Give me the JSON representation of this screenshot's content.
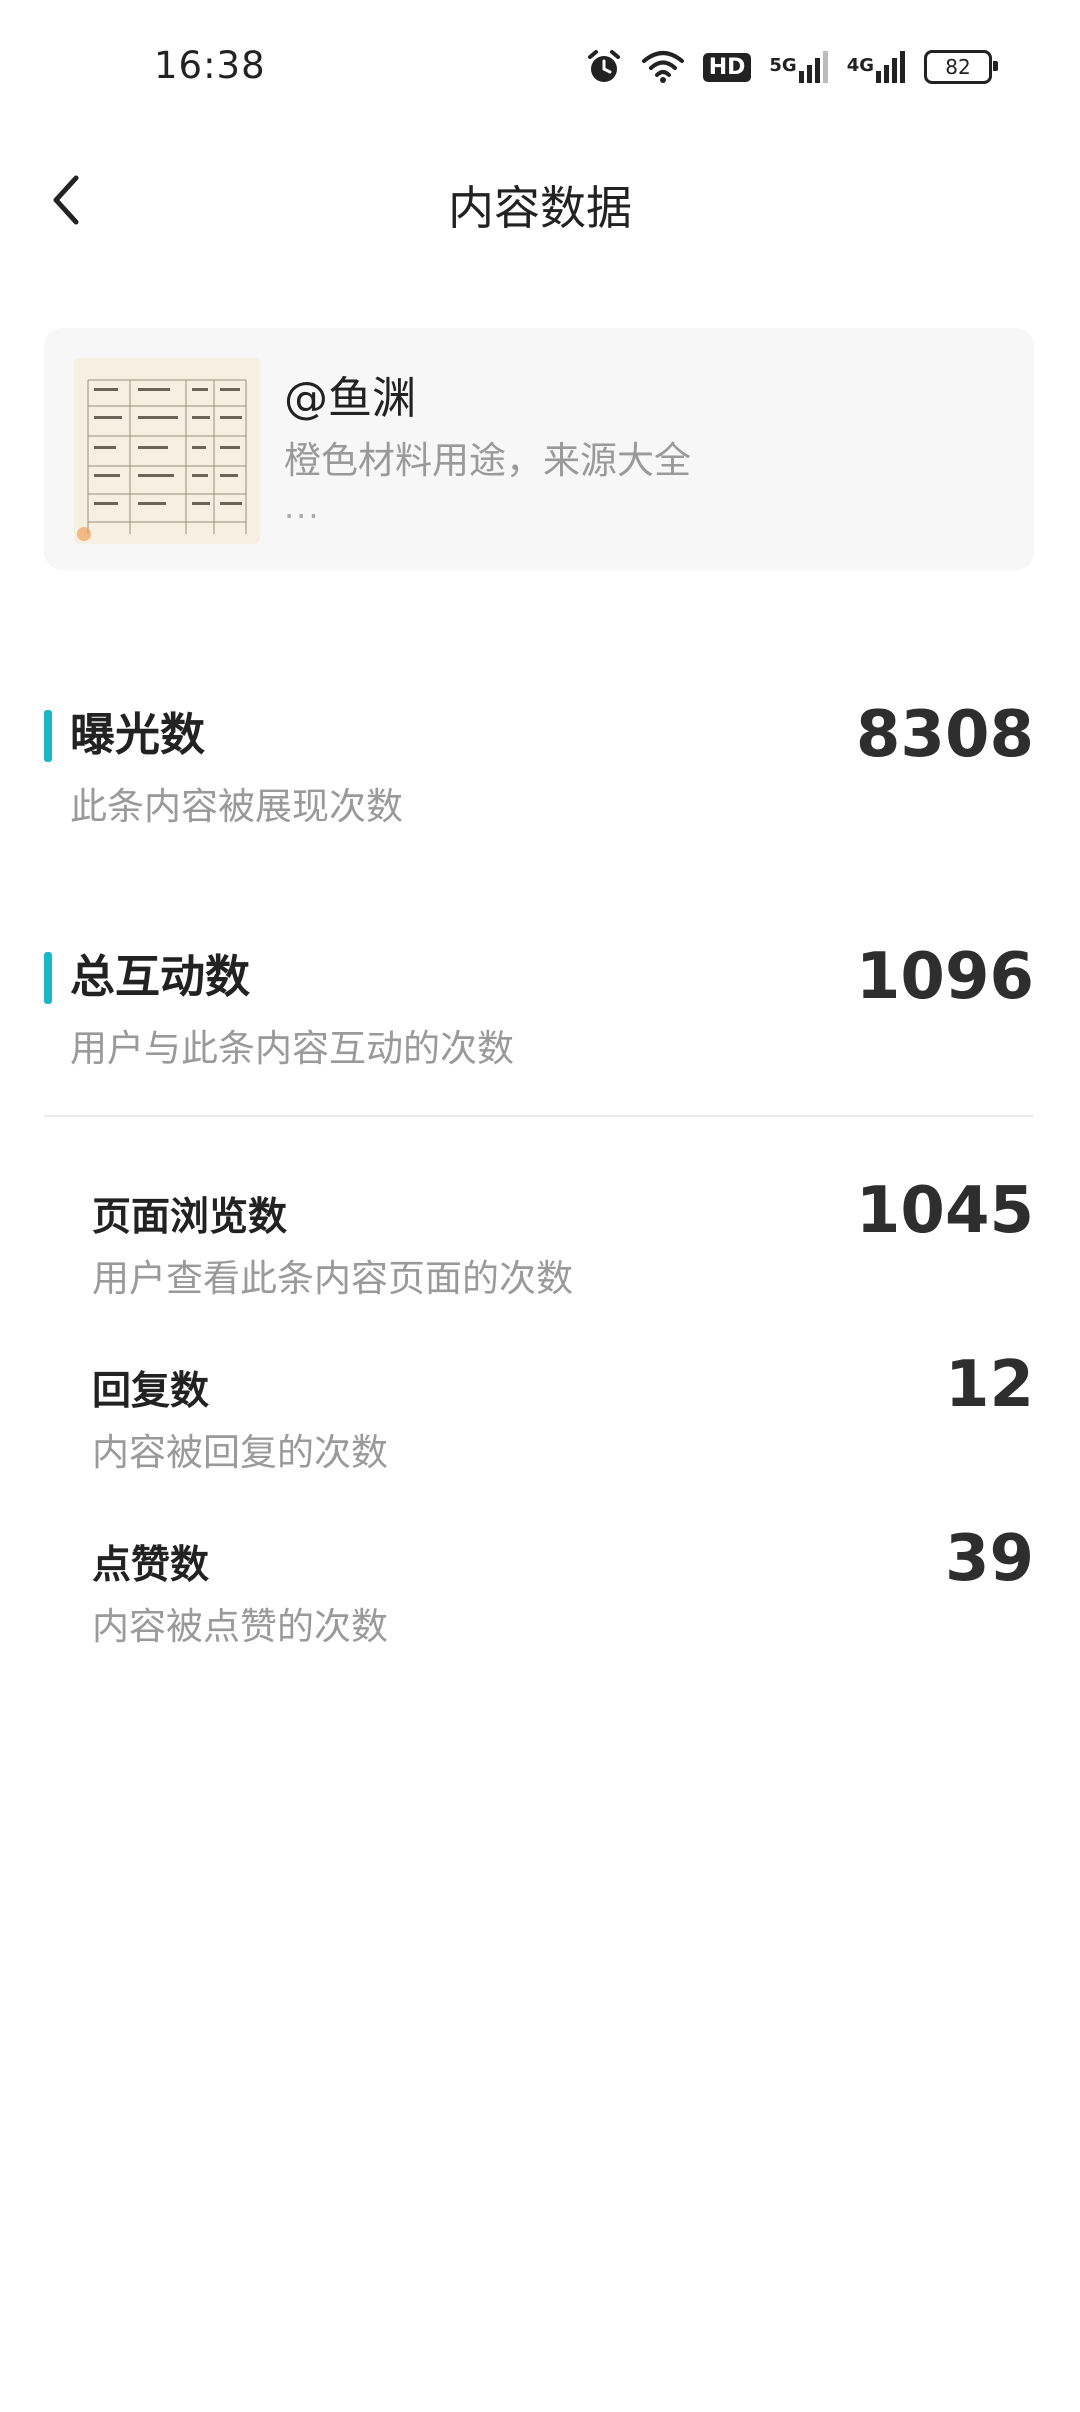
{
  "status_bar": {
    "time": "16:38",
    "icons": [
      "alarm-icon",
      "wifi-icon",
      "hd-icon",
      "signal-5g-icon",
      "signal-4g-icon",
      "battery-icon"
    ],
    "hd_label": "HD",
    "net1_label": "5G",
    "net2_label": "4G",
    "battery_level": "82"
  },
  "header": {
    "title": "内容数据",
    "back_icon": "chevron-left-icon"
  },
  "content_card": {
    "author": "@鱼渊",
    "excerpt": "橙色材料用途，来源大全",
    "ellipsis": "..."
  },
  "metrics": [
    {
      "label": "曝光数",
      "desc": "此条内容被展现次数",
      "value": "8308"
    },
    {
      "label": "总互动数",
      "desc": "用户与此条内容互动的次数",
      "value": "1096"
    }
  ],
  "sub_metrics": [
    {
      "label": "页面浏览数",
      "desc": "用户查看此条内容页面的次数",
      "value": "1045"
    },
    {
      "label": "回复数",
      "desc": "内容被回复的次数",
      "value": "12"
    },
    {
      "label": "点赞数",
      "desc": "内容被点赞的次数",
      "value": "39"
    }
  ],
  "colors": {
    "accent": "#1ab7c7",
    "text_primary": "#222222",
    "text_secondary": "#9a9a9a",
    "card_bg": "#f7f7f7"
  }
}
